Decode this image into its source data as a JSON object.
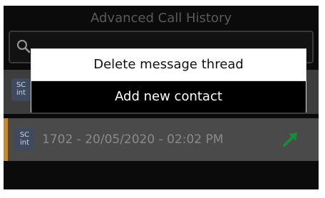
{
  "app": {
    "title": "Advanced Call History"
  },
  "search": {
    "icon": "search-icon"
  },
  "calls": [
    {
      "badge_line1": "SC",
      "badge_line2": "int",
      "text": "",
      "direction_icon": "none"
    },
    {
      "badge_line1": "SC",
      "badge_line2": "int",
      "text": "1702 - 20/05/2020 - 02:02 PM",
      "direction_icon": "outgoing-arrow-icon"
    }
  ],
  "context_menu": {
    "items": [
      {
        "label": "Delete message thread"
      },
      {
        "label": "Add new contact"
      }
    ]
  },
  "colors": {
    "background": "#0b0b0b",
    "selected_row_accent": "#c9872b",
    "outgoing_arrow": "#1a8a3a",
    "badge_bg": "#3f4a5e"
  }
}
